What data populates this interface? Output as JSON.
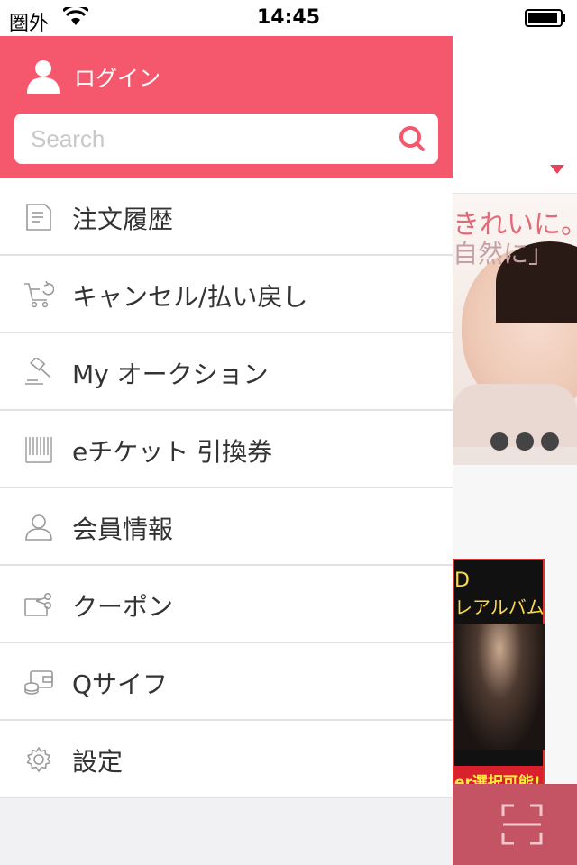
{
  "status_bar": {
    "carrier": "圏外",
    "time": "14:45"
  },
  "drawer": {
    "login_label": "ログイン",
    "search": {
      "placeholder": "Search"
    },
    "menu": [
      {
        "label": "注文履歴",
        "icon": "receipt-icon"
      },
      {
        "label": "キャンセル/払い戻し",
        "icon": "cart-return-icon"
      },
      {
        "label": "My オークション",
        "icon": "gavel-icon"
      },
      {
        "label": "eチケット 引換券",
        "icon": "barcode-icon"
      },
      {
        "label": "会員情報",
        "icon": "person-icon"
      },
      {
        "label": "クーポン",
        "icon": "coupon-icon"
      },
      {
        "label": "Qサイフ",
        "icon": "wallet-icon"
      },
      {
        "label": "設定",
        "icon": "gear-icon"
      }
    ]
  },
  "background": {
    "banner_text_1": "きれいに。",
    "banner_text_2": "自然に」",
    "album_text_1": "D",
    "album_text_2": "レアルバム",
    "album_footer": "er選択可能!"
  },
  "colors": {
    "accent": "#f5586c",
    "bottom_bar": "#c45464"
  }
}
